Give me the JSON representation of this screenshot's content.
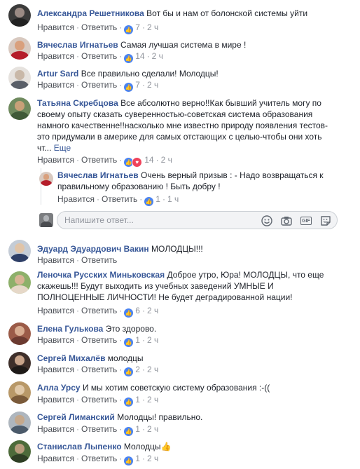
{
  "ui": {
    "like": "Нравится",
    "reply": "Ответить",
    "more": "Еще",
    "reply_placeholder": "Напишите ответ..."
  },
  "comments": [
    {
      "name": "Александра Решетникова",
      "text": "Вот бы и нам от болонской системы уйти",
      "likes": "7",
      "time": "2 ч",
      "avatar_colors": [
        "#3b3b3b",
        "#9a8a84"
      ]
    },
    {
      "name": "Вячеслав Игнатьев",
      "text": "Самая лучшая система в мире !",
      "likes": "14",
      "time": "2 ч",
      "avatar_colors": [
        "#b51d2a",
        "#d9a07d"
      ]
    },
    {
      "name": "Artur Sard",
      "text": "Все правильно сделали! Молодцы!",
      "likes": "7",
      "time": "2 ч",
      "avatar_colors": [
        "#5a5f68",
        "#c9b8a8"
      ]
    },
    {
      "name": "Татьяна Скребцова",
      "text_lines": [
        "Все абсолютно верно!!Как бывший учитель могу по",
        "своему опыту сказать суверенностью-советская система образования",
        "намного качественне!!насколько мне известно природу появления тестов-",
        "это придумали в америке для самых отстающих с целью-чтобы они хоть",
        "чт..."
      ],
      "likes": "14",
      "time": "2 ч",
      "avatar_colors": [
        "#6f8a5e",
        "#c8a078"
      ]
    },
    {
      "name": "Эдуард Эдуардович Вакин",
      "text": "МОЛОДЦЫ!!!",
      "likes": "",
      "time": "",
      "avatar_colors": [
        "#2d3e66",
        "#e0c4a8"
      ]
    },
    {
      "name": "Леночка Русских Миньковская",
      "text_lines": [
        "Доброе утро, Юра! МОЛОДЦЫ, что еще",
        "скажешь!!! Будут выходить из учебных заведений УМНЫЕ И",
        "ПОЛНОЦЕННЫЕ ЛИЧНОСТИ! Не будет деградированной нации!"
      ],
      "likes": "6",
      "time": "2 ч",
      "avatar_colors": [
        "#8db06a",
        "#d7b494"
      ]
    },
    {
      "name": "Елена Гулькова",
      "text": "Это здорово.",
      "likes": "1",
      "time": "2 ч",
      "avatar_colors": [
        "#9b5b48",
        "#d8ac90"
      ]
    },
    {
      "name": "Сергей Михалёв",
      "text": "молодцы",
      "likes": "2",
      "time": "2 ч",
      "avatar_colors": [
        "#3e2f2a",
        "#c8a48a"
      ]
    },
    {
      "name": "Алла Урсу",
      "text": "И мы хотим советскую систему образования :-((",
      "likes": "1",
      "time": "2 ч",
      "avatar_colors": [
        "#b89868",
        "#e0c8a8"
      ]
    },
    {
      "name": "Сергей Лиманский",
      "text": "Молодцы! правильно.",
      "likes": "1",
      "time": "2 ч",
      "avatar_colors": [
        "#4b5a6a",
        "#c4a88c"
      ]
    },
    {
      "name": "Станислав Лыпенко",
      "text": "Молодцы👍",
      "likes": "1",
      "time": "2 ч",
      "avatar_colors": [
        "#4d6b3a",
        "#b89c7c"
      ]
    }
  ],
  "reply": {
    "name": "Вячеслав Игнатьев",
    "text_lines": [
      "Очень верный призыв : - Надо возвращаться к",
      "правильному образованию ! Быть добру !"
    ],
    "likes": "1",
    "time": "1 ч",
    "avatar_colors": [
      "#b51d2a",
      "#d9a07d"
    ]
  },
  "reply_box_icons": [
    "emoji-icon",
    "camera-icon",
    "gif-icon",
    "sticker-icon"
  ]
}
